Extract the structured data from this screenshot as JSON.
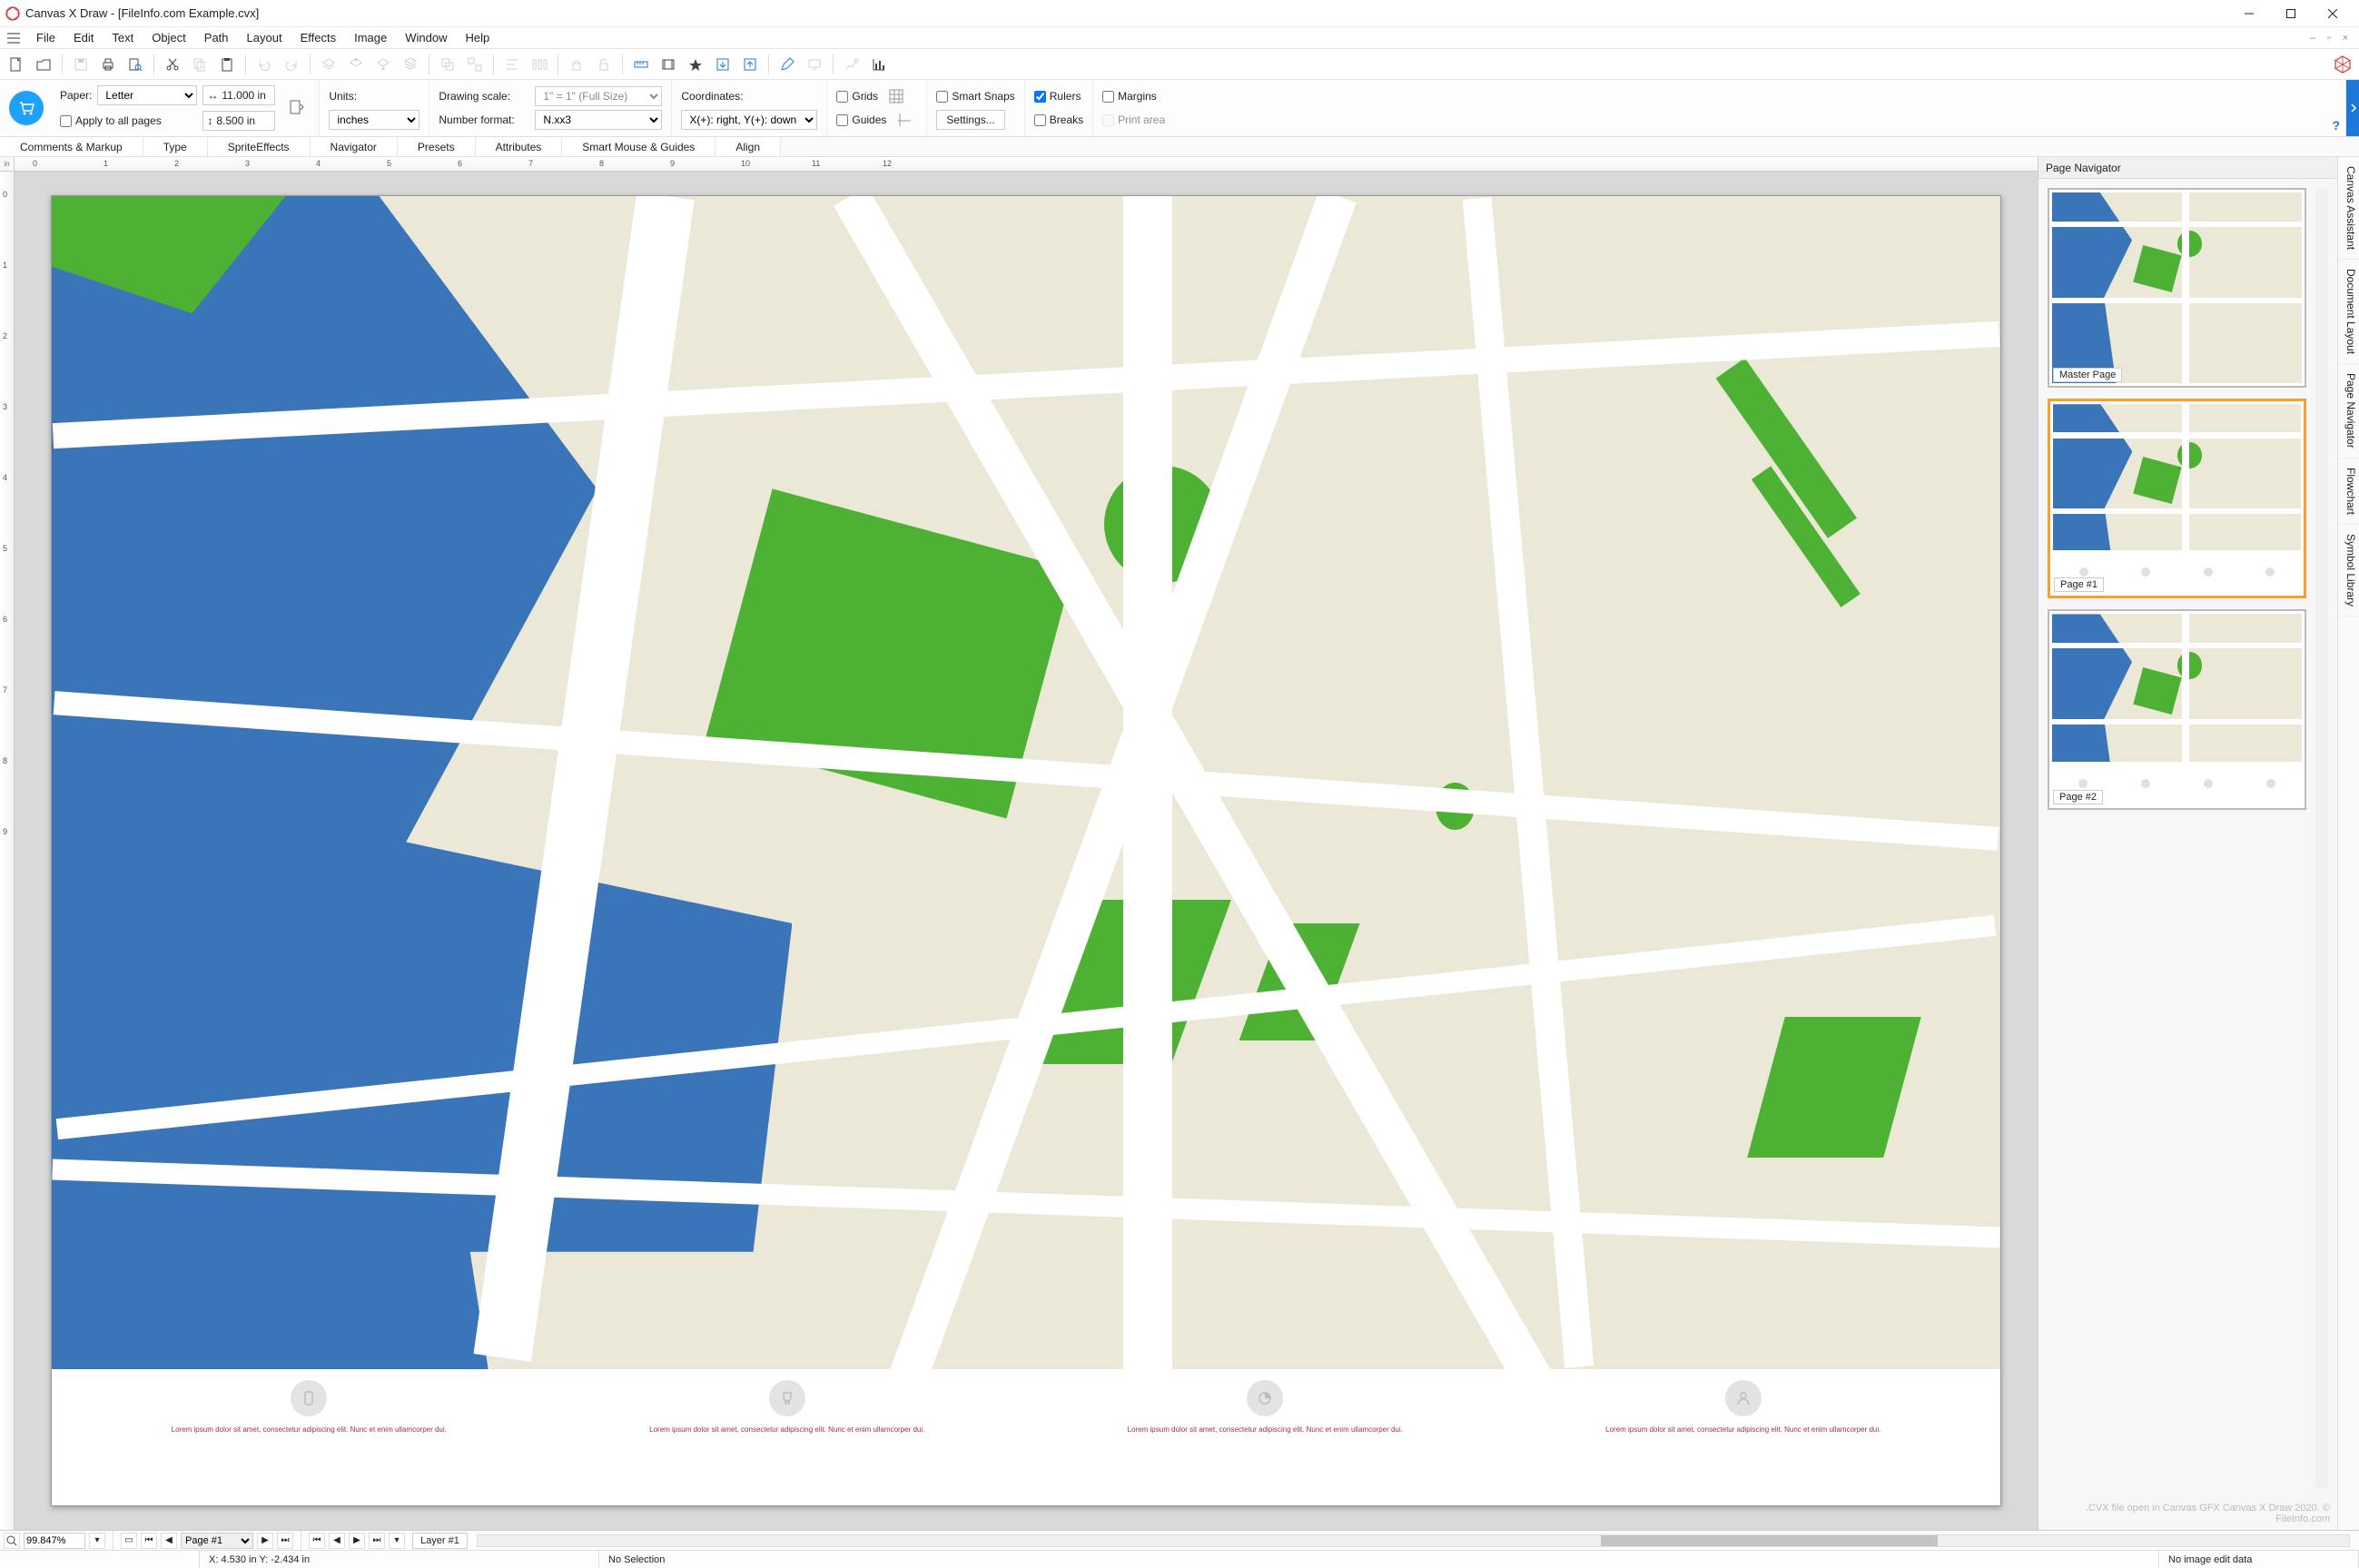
{
  "title": "Canvas X Draw  -  [FileInfo.com Example.cvx]",
  "menus": [
    "File",
    "Edit",
    "Text",
    "Object",
    "Path",
    "Layout",
    "Effects",
    "Image",
    "Window",
    "Help"
  ],
  "ribbon": {
    "paper": {
      "label": "Paper:",
      "value": "Letter",
      "width_label": "11.000 in",
      "height_label": "8.500 in",
      "apply_all": "Apply to all pages"
    },
    "units": {
      "label": "Units:",
      "value": "inches"
    },
    "drawing_scale": {
      "label": "Drawing scale:",
      "value": "1\" = 1\" (Full Size)"
    },
    "number_format": {
      "label": "Number format:",
      "value": "N.xx3"
    },
    "coordinates": {
      "label": "Coordinates:",
      "value": "X(+): right, Y(+): down"
    },
    "checks": {
      "grids": "Grids",
      "guides": "Guides",
      "smart": "Smart Snaps",
      "rulers": "Rulers",
      "margins": "Margins",
      "breaks": "Breaks",
      "print_area": "Print area"
    },
    "settings_btn": "Settings..."
  },
  "tabs": [
    "Comments & Markup",
    "Type",
    "SpriteEffects",
    "Navigator",
    "Presets",
    "Attributes",
    "Smart Mouse & Guides",
    "Align"
  ],
  "page_navigator": {
    "title": "Page Navigator",
    "thumbs": [
      "Master Page",
      "Page #1",
      "Page #2"
    ],
    "selected": 1
  },
  "side_tabs": [
    "Canvas Assistant",
    "Document Layout",
    "Page Navigator",
    "Flowchart",
    "Symbol Library"
  ],
  "bottom": {
    "zoom": "99.847%",
    "page_select": "Page #1",
    "layer": "Layer #1",
    "coords": "X: 4.530 in Y: -2.434 in",
    "selection": "No Selection",
    "editdata": "No image edit data"
  },
  "watermark": ".CVX file open in Canvas GFX Canvas X Draw 2020. © FileInfo.com",
  "lorem": "Lorem ipsum dolor sit amet, consectetur adipiscing elit. Nunc et enim ullamcorper dui.",
  "ruler_corner": "in"
}
